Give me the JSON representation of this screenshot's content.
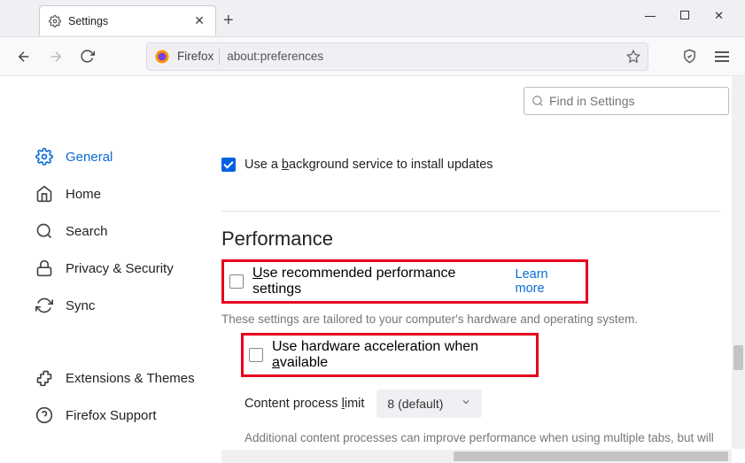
{
  "tab": {
    "title": "Settings"
  },
  "urlbar": {
    "brand": "Firefox",
    "address": "about:preferences"
  },
  "search": {
    "placeholder": "Find in Settings"
  },
  "sidebar": {
    "items": [
      {
        "label": "General"
      },
      {
        "label": "Home"
      },
      {
        "label": "Search"
      },
      {
        "label": "Privacy & Security"
      },
      {
        "label": "Sync"
      }
    ],
    "bottom": [
      {
        "label": "Extensions & Themes"
      },
      {
        "label": "Firefox Support"
      }
    ]
  },
  "updates": {
    "bg_service": "Use a background service to install updates"
  },
  "perf": {
    "heading": "Performance",
    "recommended": "Use recommended performance settings",
    "learn_more": "Learn more",
    "desc": "These settings are tailored to your computer's hardware and operating system.",
    "hw_accel": "Use hardware acceleration when available",
    "proc_limit_label": "Content process limit",
    "proc_limit_value": "8 (default)",
    "proc_desc": "Additional content processes can improve performance when using multiple tabs, but will also use more memory."
  }
}
